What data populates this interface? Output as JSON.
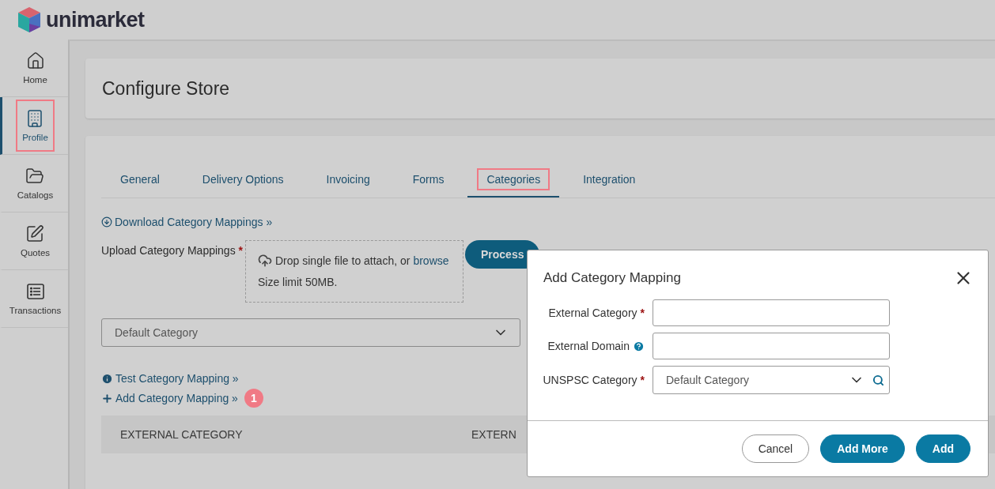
{
  "brand": "unimarket",
  "sidebar": [
    {
      "label": "Home",
      "selected": false,
      "highlighted": false
    },
    {
      "label": "Profile",
      "selected": true,
      "highlighted": true
    },
    {
      "label": "Catalogs",
      "selected": false,
      "highlighted": false
    },
    {
      "label": "Quotes",
      "selected": false,
      "highlighted": false
    },
    {
      "label": "Transactions",
      "selected": false,
      "highlighted": false
    }
  ],
  "page_title": "Configure Store",
  "tabs": [
    {
      "label": "General",
      "selected": false,
      "highlighted": false
    },
    {
      "label": "Delivery Options",
      "selected": false,
      "highlighted": false
    },
    {
      "label": "Invoicing",
      "selected": false,
      "highlighted": false
    },
    {
      "label": "Forms",
      "selected": false,
      "highlighted": false
    },
    {
      "label": "Categories",
      "selected": true,
      "highlighted": true
    },
    {
      "label": "Integration",
      "selected": false,
      "highlighted": false
    }
  ],
  "download_link": "Download Category Mappings »",
  "upload": {
    "label": "Upload Category Mappings",
    "required_mark": "*",
    "drop_text": "Drop single file to attach, or",
    "browse_link": "browse",
    "size_limit": "Size limit 50MB."
  },
  "process_button": "Process",
  "category_select": {
    "value": "Default Category"
  },
  "links": [
    {
      "kind": "info",
      "label": "Test Category Mapping »"
    },
    {
      "kind": "add",
      "label": "Add Category Mapping »",
      "badge": "1"
    }
  ],
  "table": {
    "columns": [
      "EXTERNAL CATEGORY",
      "EXTERN"
    ]
  },
  "dialog": {
    "title": "Add Category Mapping",
    "fields": [
      {
        "label": "External Category",
        "kind": "text",
        "required_mark": "*",
        "help": false
      },
      {
        "label": "External Domain",
        "kind": "text",
        "help": true
      },
      {
        "label": "UNSPSC Category",
        "kind": "select",
        "required_mark": "*",
        "help": false,
        "value": "Default Category"
      }
    ],
    "buttons": [
      {
        "label": "Cancel",
        "kind": "secondary"
      },
      {
        "label": "Add More",
        "kind": "primary"
      },
      {
        "label": "Add",
        "kind": "primary"
      }
    ]
  }
}
